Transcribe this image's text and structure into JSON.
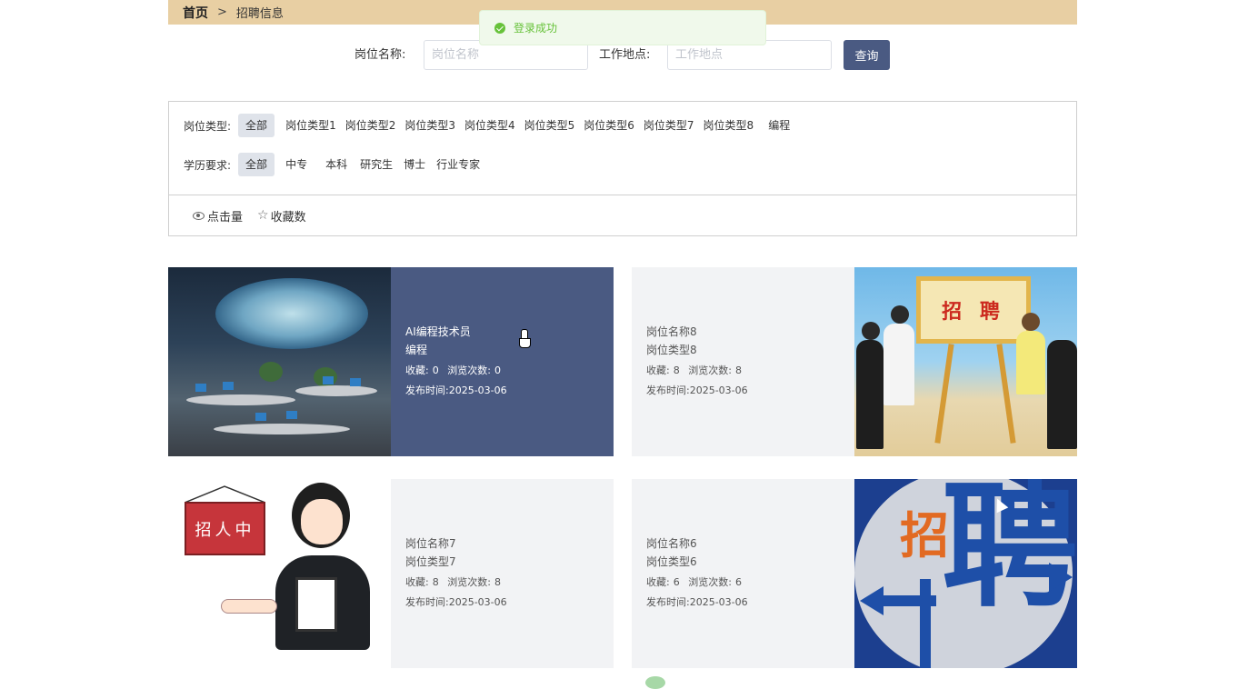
{
  "breadcrumb": {
    "home": "首页",
    "separator": ">",
    "current": "招聘信息"
  },
  "toast": {
    "message": "登录成功",
    "color": "#67c23a"
  },
  "search": {
    "position_label": "岗位名称:",
    "position_placeholder": "岗位名称",
    "location_label": "工作地点:",
    "location_placeholder": "工作地点",
    "query_button": "查询"
  },
  "filters": {
    "job_type": {
      "label": "岗位类型:",
      "options": [
        "全部",
        "岗位类型1",
        "岗位类型2",
        "岗位类型3",
        "岗位类型4",
        "岗位类型5",
        "岗位类型6",
        "岗位类型7",
        "岗位类型8",
        "编程"
      ],
      "selected": "全部"
    },
    "education": {
      "label": "学历要求:",
      "options": [
        "全部",
        "中专",
        "本科",
        "研究生",
        "博士",
        "行业专家"
      ],
      "selected": "全部"
    }
  },
  "sort": {
    "clicks": "点击量",
    "favorites": "收藏数"
  },
  "cards": [
    {
      "title": "AI编程技术员",
      "type": "编程",
      "fav_label": "收藏:",
      "fav": "0",
      "views_label": "浏览次数:",
      "views": "0",
      "date_label": "发布时间:",
      "date": "2025-03-06",
      "image": "office-icon"
    },
    {
      "title": "岗位名称8",
      "type": "岗位类型8",
      "fav_label": "收藏:",
      "fav": "8",
      "views_label": "浏览次数:",
      "views": "8",
      "date_label": "发布时间:",
      "date": "2025-03-06",
      "image": "recruitment-board-icon",
      "image_text": "招 聘"
    },
    {
      "title": "岗位名称7",
      "type": "岗位类型7",
      "fav_label": "收藏:",
      "fav": "8",
      "views_label": "浏览次数:",
      "views": "8",
      "date_label": "发布时间:",
      "date": "2025-03-06",
      "image": "hiring-person-icon",
      "image_text": "招人中"
    },
    {
      "title": "岗位名称6",
      "type": "岗位类型6",
      "fav_label": "收藏:",
      "fav": "6",
      "views_label": "浏览次数:",
      "views": "6",
      "date_label": "发布时间:",
      "date": "2025-03-06",
      "image": "pin-character-icon",
      "image_text_big": "聘",
      "image_text_small": "招"
    }
  ],
  "colors": {
    "breadcrumb_bg": "#e8cfa3",
    "accent": "#4a5a82",
    "card_bg": "#f2f3f5"
  }
}
